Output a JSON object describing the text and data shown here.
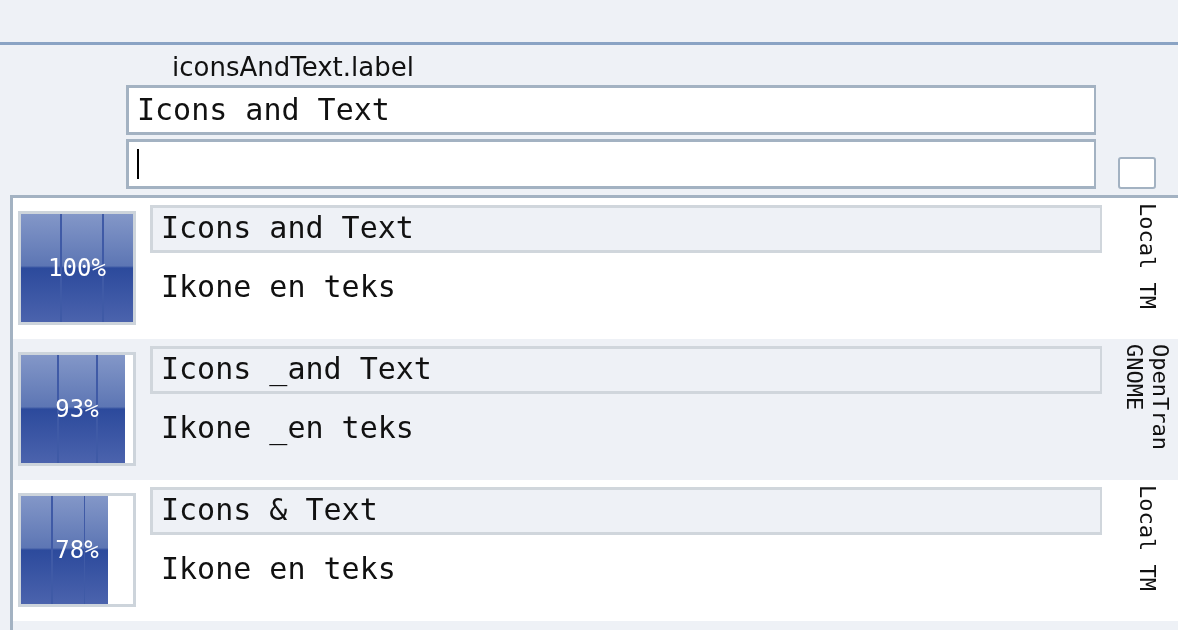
{
  "editor": {
    "label": "iconsAndText.label",
    "source": "Icons and Text",
    "fuzzy_checked": false
  },
  "suggestions": [
    {
      "match": "100%",
      "level": 1.0,
      "source": "Icons and Text",
      "target": "Ikone en teks",
      "origin_lines": [
        "Local TM"
      ]
    },
    {
      "match": "93%",
      "level": 0.93,
      "source": "Icons _and Text",
      "target": "Ikone _en teks",
      "origin_lines": [
        "OpenTran",
        "GNOME"
      ]
    },
    {
      "match": "78%",
      "level": 0.78,
      "source": "Icons & Text",
      "target": "Ikone en teks",
      "origin_lines": [
        "Local TM"
      ]
    }
  ]
}
